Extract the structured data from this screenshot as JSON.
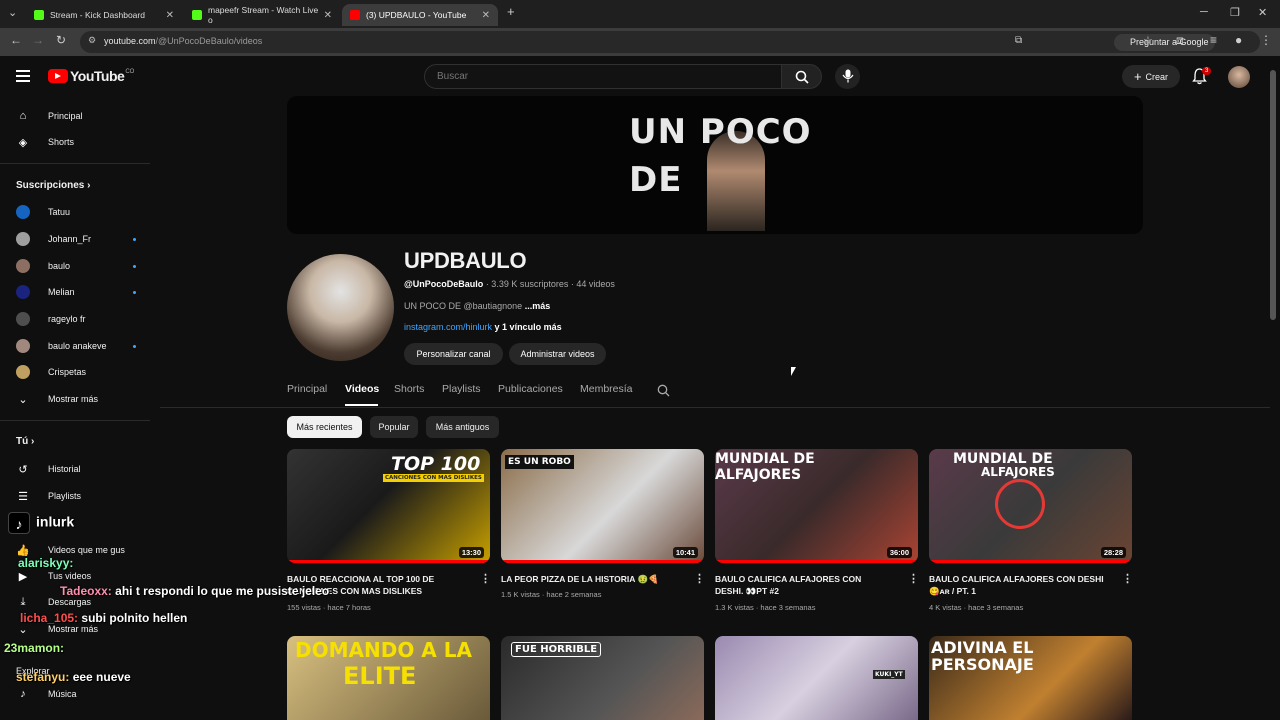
{
  "browser": {
    "tabs": [
      {
        "label": "Stream - Kick Dashboard"
      },
      {
        "label": "mapeefr Stream - Watch Live o"
      },
      {
        "label": "(3) UPDBAULO - YouTube"
      }
    ],
    "url_host": "youtube.com",
    "url_path": "/@UnPocoDeBaulo/videos",
    "ask_google": "Preguntar a Google"
  },
  "header": {
    "logo": "YouTube",
    "logo_cc": "CO",
    "search_placeholder": "Buscar",
    "create": "Crear",
    "notif_count": "3"
  },
  "sidebar": {
    "main": [
      "Principal",
      "Shorts"
    ],
    "subs_title": "Suscripciones",
    "subs": [
      "Tatuu",
      "Johann_Fr",
      "baulo",
      "Melian",
      "rageylo fr",
      "baulo anakeve",
      "Crispetas"
    ],
    "show_more": "Mostrar más",
    "you_title": "Tú",
    "you": [
      "Historial",
      "Playlists",
      "Videos que me gus",
      "Tus videos",
      "Descargas",
      "Mostrar más"
    ],
    "explore": "Explorar",
    "music": "Música"
  },
  "channel": {
    "banner_line1": "UN POCO",
    "banner_line2": "DE",
    "name": "UPDBAULO",
    "handle": "@UnPocoDeBaulo",
    "stats": "· 3.39 K suscriptores · 44 videos",
    "desc": "UN POCO DE @bautiagnone",
    "more": "...más",
    "link": "instagram.com/hinlurk",
    "link_more": "y 1 vínculo más",
    "btn_customize": "Personalizar canal",
    "btn_manage": "Administrar videos"
  },
  "tabs": [
    "Principal",
    "Videos",
    "Shorts",
    "Playlists",
    "Publicaciones",
    "Membresía"
  ],
  "chips": [
    "Más recientes",
    "Popular",
    "Más antiguos"
  ],
  "videos": [
    {
      "title": "BAULO REACCIONA AL TOP 100 DE CANCIONES CON MAS DISLIKES",
      "meta": "155 vistas · hace 7 horas",
      "duration": "13:30",
      "thumb_text": "TOP 100",
      "thumb_sub": "CANCIONES CON MAS DISLIKES"
    },
    {
      "title": "LA PEOR PIZZA DE LA HISTORIA 🤢🍕",
      "meta": "1.5 K vistas · hace 2 semanas",
      "duration": "10:41",
      "thumb_text": "ES UN ROBO"
    },
    {
      "title": "BAULO CALIFICA ALFAJORES CON DESHI. 👀PT #2",
      "meta": "1.3 K vistas · hace 3 semanas",
      "duration": "36:00",
      "thumb_text": "MUNDIAL DE",
      "thumb_sub": "ALFAJORES"
    },
    {
      "title": "BAULO CALIFICA ALFAJORES CON DESHI 😋ᴀʀ / PT. 1",
      "meta": "4 K vistas · hace 3 semanas",
      "duration": "28:28",
      "thumb_text": "MUNDIAL DE",
      "thumb_sub": "ALFAJORES"
    }
  ],
  "videos_row2": [
    {
      "thumb_text": "DOMANDO A LA",
      "thumb_sub": "ELITE"
    },
    {
      "thumb_text": "FUE HORRIBLE"
    },
    {
      "thumb_text": "KUKI_YT"
    },
    {
      "thumb_text": "ADIVINA EL",
      "thumb_sub": "PERSONAJE"
    }
  ],
  "overlay": {
    "tiktok": "inlurk",
    "chat": [
      {
        "user": "alariskyy:",
        "msg": ""
      },
      {
        "user": "Tadeoxx:",
        "msg": "ahi t respondi lo que me pusiste jeleo"
      },
      {
        "user": "licha_105:",
        "msg": "subi polnito hellen"
      },
      {
        "user": "23mamon:",
        "msg": ""
      },
      {
        "user": "stefanyu:",
        "msg": "eee nueve"
      }
    ]
  },
  "colors": {
    "accent": "#ff0000",
    "link": "#3ea6ff",
    "bg": "#0f0f0f"
  }
}
